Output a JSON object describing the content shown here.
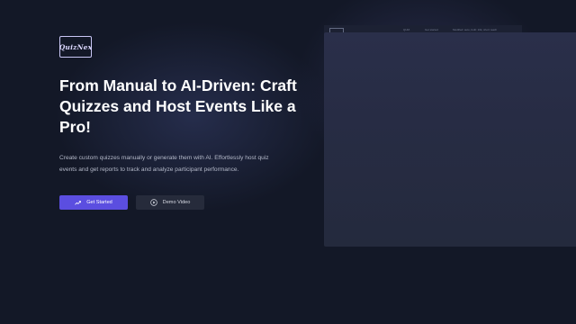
{
  "brand": {
    "logo_text": "QuizNex"
  },
  "hero": {
    "headline": "From Manual to AI-Driven: Craft Quizzes and Host Events Like a Pro!",
    "description": "Create custom quizzes manually or generate them with AI. Effortlessly host quiz events and get reports to track and analyze participant performance."
  },
  "buttons": {
    "get_started": "Get Started",
    "demo_video": "Demo Video"
  },
  "icons": {
    "get_started": "trending-up-icon",
    "demo_video": "play-circle-icon"
  },
  "preview": {
    "tabs": [
      "QUIZ",
      "Get started",
      "Modified: auto, built: 10k, short reach"
    ]
  },
  "colors": {
    "background": "#131827",
    "accent": "#5b4ee0",
    "secondary_button": "#262b3b",
    "text": "#ffffff",
    "muted_text": "#b4b9c9"
  }
}
